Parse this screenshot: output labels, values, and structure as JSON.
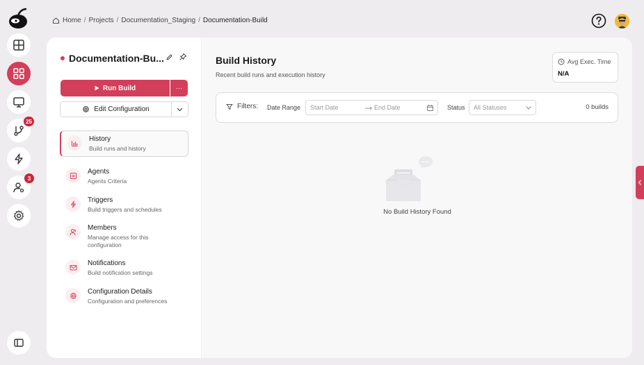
{
  "rail": {
    "badges": {
      "git": "25",
      "users": "3"
    }
  },
  "breadcrumb": {
    "items": [
      "Home",
      "Projects",
      "Documentation_Staging",
      "Documentation-Build"
    ]
  },
  "project": {
    "name": "Documentation-Bu...",
    "run_label": "Run Build",
    "more_label": "···",
    "edit_label": "Edit Configuration"
  },
  "nav": [
    {
      "title": "History",
      "sub": "Build runs and history",
      "icon": "chart-icon"
    },
    {
      "title": "Agents",
      "sub": "Agents Criteria",
      "icon": "agent-icon"
    },
    {
      "title": "Triggers",
      "sub": "Build triggers and schedules",
      "icon": "bolt-icon"
    },
    {
      "title": "Members",
      "sub1": "Manage access for this",
      "sub2": "configuration",
      "icon": "members-icon"
    },
    {
      "title": "Notifications",
      "sub": "Build notification settings",
      "icon": "mail-icon"
    },
    {
      "title": "Configuration Details",
      "sub": "Configuration and preferences",
      "icon": "gear-icon"
    }
  ],
  "build_history": {
    "title": "Build History",
    "subtitle": "Recent build runs and execution history",
    "avg_label": "Avg Exec. Time",
    "avg_value": "N/A"
  },
  "filters": {
    "label": "Filters:",
    "date_range_label": "Date Range",
    "start_placeholder": "Start Date",
    "end_placeholder": "End Date",
    "status_label": "Status",
    "status_value": "All Statuses",
    "count": "0 builds"
  },
  "empty": {
    "text": "No Build History Found"
  },
  "colors": {
    "accent": "#d33e5a",
    "badge": "#c8283a"
  }
}
